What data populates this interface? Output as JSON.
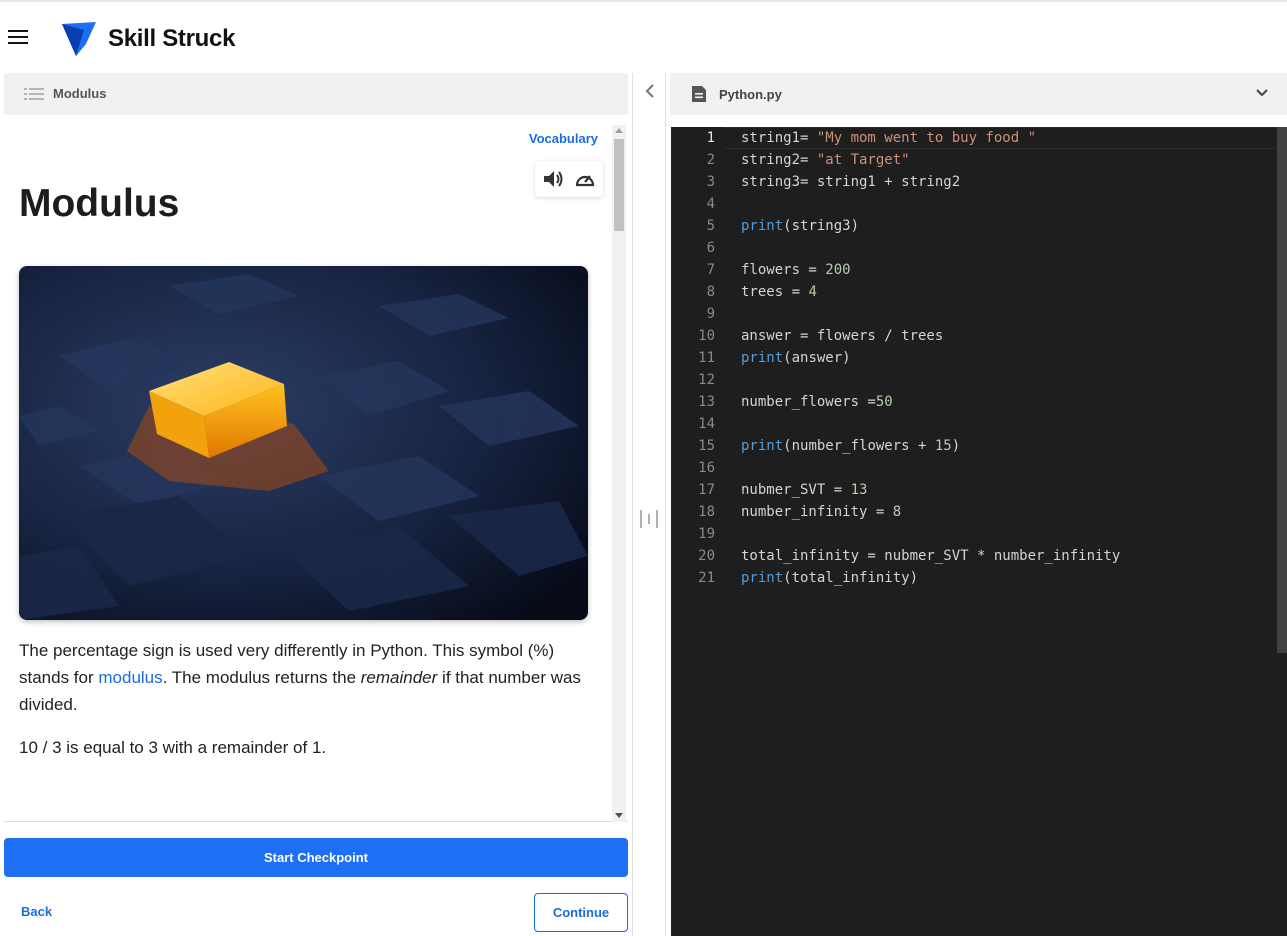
{
  "app": {
    "brand": "Skill Struck"
  },
  "lesson": {
    "header_title": "Modulus",
    "vocabulary_link": "Vocabulary",
    "title": "Modulus",
    "paragraph1_before_link": "The percentage sign is used very differently in Python.  This symbol (%) stands for ",
    "paragraph1_link": "modulus",
    "paragraph1_middle": ".  The modulus returns the ",
    "paragraph1_emphasis": "remainder",
    "paragraph1_after": " if that number was divided.",
    "paragraph2": "10 / 3 is equal to 3 with a remainder of 1.",
    "icons": [
      "volume-icon",
      "speed-gauge-icon",
      "list-icon"
    ]
  },
  "actions": {
    "start_checkpoint": "Start Checkpoint",
    "back": "Back",
    "continue": "Continue"
  },
  "editor": {
    "filename": "Python.py",
    "active_line": 1,
    "lines": [
      [
        [
          "string1= ",
          "t"
        ],
        [
          "\"My mom went to buy food \"",
          "s"
        ]
      ],
      [
        [
          "string2= ",
          "t"
        ],
        [
          "\"at Target\"",
          "s"
        ]
      ],
      [
        [
          "string3= string1 + string2",
          "t"
        ]
      ],
      [],
      [
        [
          "print",
          "f"
        ],
        [
          "(string3)",
          "t"
        ]
      ],
      [],
      [
        [
          "flowers = ",
          "t"
        ],
        [
          "200",
          "n"
        ]
      ],
      [
        [
          "trees = ",
          "t"
        ],
        [
          "4",
          "n"
        ]
      ],
      [],
      [
        [
          "answer = flowers / trees",
          "t"
        ]
      ],
      [
        [
          "print",
          "f"
        ],
        [
          "(answer)",
          "t"
        ]
      ],
      [],
      [
        [
          "number_flowers =",
          "t"
        ],
        [
          "50",
          "n"
        ]
      ],
      [],
      [
        [
          "print",
          "f"
        ],
        [
          "(number_flowers + ",
          "t"
        ],
        [
          "15",
          "n"
        ],
        [
          ")",
          "t"
        ]
      ],
      [],
      [
        [
          "nubmer_SVT = ",
          "t"
        ],
        [
          "13",
          "n"
        ]
      ],
      [
        [
          "number_infinity = ",
          "t"
        ],
        [
          "8",
          "n"
        ]
      ],
      [],
      [
        [
          "total_infinity = nubmer_SVT * number_infinity",
          "t"
        ]
      ],
      [
        [
          "print",
          "f"
        ],
        [
          "(total_infinity)",
          "t"
        ]
      ]
    ]
  },
  "colors": {
    "accent": "#1f6ff5",
    "link": "#1a6cdf",
    "editor_bg": "#1e1e1e",
    "string": "#ce9178",
    "keyword": "#569cd6",
    "number": "#b5cea8"
  }
}
